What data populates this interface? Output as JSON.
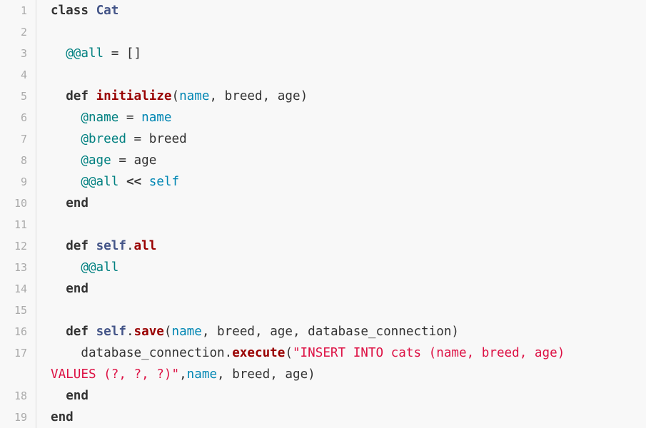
{
  "editor": {
    "language": "ruby",
    "colors": {
      "background": "#f8f8f8",
      "line_number": "#aaaaaa",
      "keyword": "#333333",
      "class_name": "#445588",
      "method_name": "#990000",
      "variable": "#008080",
      "parameter": "#0086b3",
      "string": "#dd1144"
    },
    "line_numbers": [
      "1",
      "2",
      "3",
      "4",
      "5",
      "6",
      "7",
      "8",
      "9",
      "10",
      "11",
      "12",
      "13",
      "14",
      "15",
      "16",
      "17",
      "18",
      "19"
    ],
    "lines": [
      {
        "tokens": [
          "class",
          " ",
          "Cat"
        ]
      },
      {
        "tokens": []
      },
      {
        "tokens": [
          "  ",
          "@@all",
          " = []"
        ]
      },
      {
        "tokens": []
      },
      {
        "tokens": [
          "  ",
          "def",
          " ",
          "initialize",
          "(",
          "name",
          ", breed, age)"
        ]
      },
      {
        "tokens": [
          "    ",
          "@name",
          " = ",
          "name"
        ]
      },
      {
        "tokens": [
          "    ",
          "@breed",
          " = breed"
        ]
      },
      {
        "tokens": [
          "    ",
          "@age",
          " = age"
        ]
      },
      {
        "tokens": [
          "    ",
          "@@all",
          " ",
          "<<",
          " ",
          "self"
        ]
      },
      {
        "tokens": [
          "  ",
          "end"
        ]
      },
      {
        "tokens": []
      },
      {
        "tokens": [
          "  ",
          "def",
          " ",
          "self",
          ".",
          "all"
        ]
      },
      {
        "tokens": [
          "    ",
          "@@all"
        ]
      },
      {
        "tokens": [
          "  ",
          "end"
        ]
      },
      {
        "tokens": []
      },
      {
        "tokens": [
          "  ",
          "def",
          " ",
          "self",
          ".",
          "save",
          "(",
          "name",
          ", breed, age, database_connection)"
        ]
      },
      {
        "tokens": [
          "    database_connection.",
          "execute",
          "(",
          "\"INSERT INTO cats (name, breed, age)"
        ],
        "wrap_tokens": [
          "VALUES (?, ?, ?)\"",
          ",",
          "name",
          ", breed, age)"
        ]
      },
      {
        "tokens": [
          "  ",
          "end"
        ]
      },
      {
        "tokens": [
          "end"
        ]
      }
    ]
  }
}
